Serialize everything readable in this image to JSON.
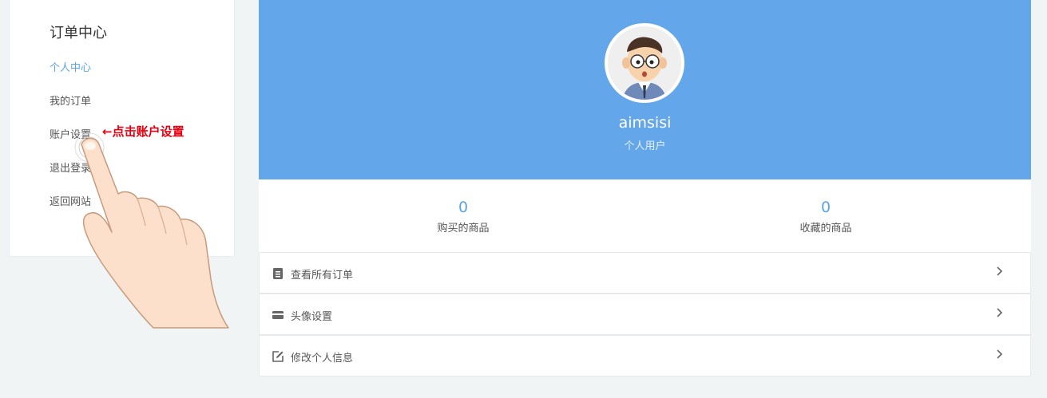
{
  "sidebar": {
    "title": "订单中心",
    "items": [
      {
        "label": "个人中心",
        "active": true
      },
      {
        "label": "我的订单",
        "active": false
      },
      {
        "label": "账户设置",
        "active": false
      },
      {
        "label": "退出登录",
        "active": false
      },
      {
        "label": "返回网站",
        "active": false
      }
    ]
  },
  "annotation": {
    "text": "←点击账户设置",
    "color": "#e60012"
  },
  "profile": {
    "username": "aimsisi",
    "user_type": "个人用户",
    "header_color": "#63a6e9"
  },
  "stats": [
    {
      "value": "0",
      "label": "购买的商品"
    },
    {
      "value": "0",
      "label": "收藏的商品"
    }
  ],
  "menu": [
    {
      "icon": "document-icon",
      "label": "查看所有订单"
    },
    {
      "icon": "card-icon",
      "label": "头像设置"
    },
    {
      "icon": "edit-icon",
      "label": "修改个人信息"
    }
  ],
  "colors": {
    "accent": "#5ea3e6",
    "background": "#f1f4f5"
  }
}
